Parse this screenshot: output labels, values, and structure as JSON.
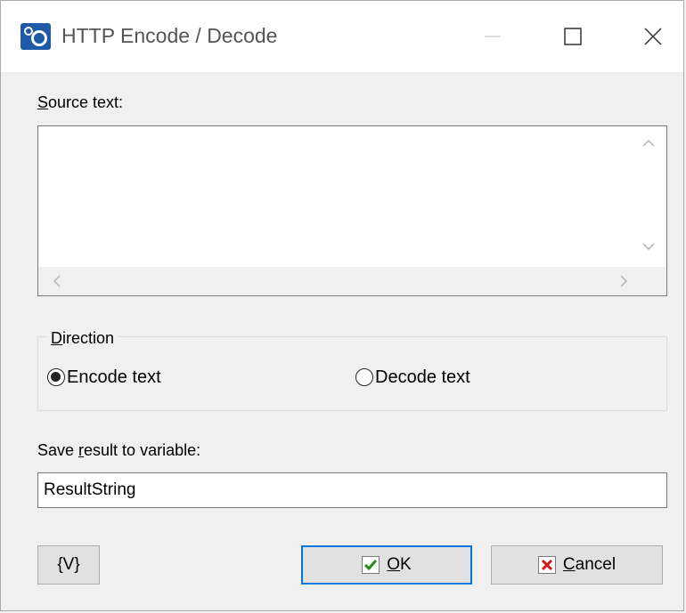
{
  "window": {
    "title": "HTTP Encode / Decode"
  },
  "source": {
    "label_underline": "S",
    "label_rest": "ource text:",
    "value": ""
  },
  "direction": {
    "label_underline": "D",
    "label_rest": "irection",
    "options": [
      {
        "label": "Encode text",
        "checked": true
      },
      {
        "label": "Decode text",
        "checked": false
      }
    ]
  },
  "save": {
    "label_before": "Save ",
    "label_underline": "r",
    "label_after": "esult to variable:",
    "value": "ResultString"
  },
  "buttons": {
    "var_label": "{V}",
    "ok_underline": "O",
    "ok_rest": "K",
    "cancel_underline": "C",
    "cancel_rest": "ancel"
  },
  "colors": {
    "accent": "#0078d7",
    "ok_check": "#2a8a1a",
    "cancel_x": "#d11a1a"
  }
}
